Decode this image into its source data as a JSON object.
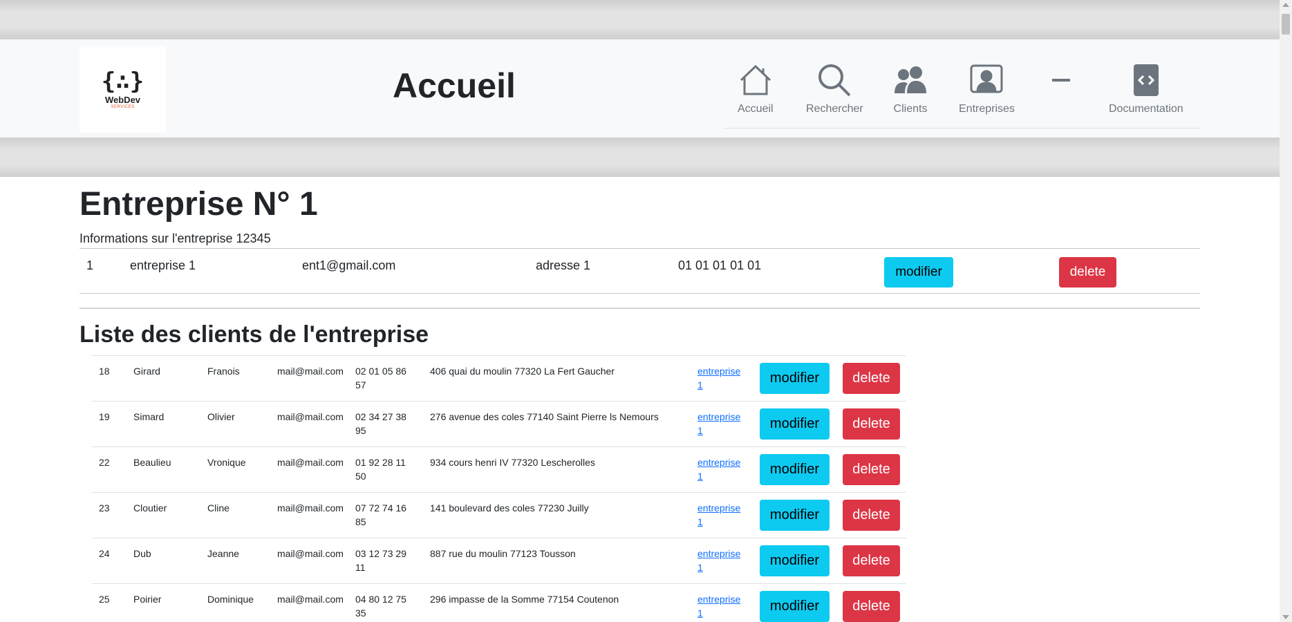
{
  "header": {
    "logo": {
      "mark": "{∴}",
      "name": "WebDev",
      "tagline": "SERVICES"
    },
    "title": "Accueil",
    "nav": [
      {
        "label": "Accueil",
        "icon": "house-icon"
      },
      {
        "label": "Rechercher",
        "icon": "search-icon"
      },
      {
        "label": "Clients",
        "icon": "people-icon"
      },
      {
        "label": "Entreprises",
        "icon": "person-badge-icon"
      },
      {
        "label": "",
        "icon": "dash-icon"
      },
      {
        "label": "Documentation",
        "icon": "code-square-icon"
      }
    ]
  },
  "entreprise": {
    "title": "Entreprise N° 1",
    "info": "Informations sur l'entreprise 12345",
    "id": "1",
    "name": "entreprise 1",
    "email": "ent1@gmail.com",
    "address": "adresse 1",
    "phone": "01 01 01 01 01",
    "modify_label": "modifier",
    "delete_label": "delete"
  },
  "clients": {
    "title": "Liste des clients de l'entreprise",
    "modify_label": "modifier",
    "delete_label": "delete",
    "rows": [
      {
        "id": "18",
        "nom": "Girard",
        "prenom": "Franois",
        "email": "mail@mail.com",
        "tel1": "02 01 05 86",
        "tel2": "57",
        "adresse": "406 quai du moulin 77320 La Fert Gaucher",
        "ent1": "entreprise",
        "ent2": "1"
      },
      {
        "id": "19",
        "nom": "Simard",
        "prenom": "Olivier",
        "email": "mail@mail.com",
        "tel1": "02 34 27 38",
        "tel2": "95",
        "adresse": "276 avenue des coles 77140 Saint Pierre ls Nemours",
        "ent1": "entreprise",
        "ent2": "1"
      },
      {
        "id": "22",
        "nom": "Beaulieu",
        "prenom": "Vronique",
        "email": "mail@mail.com",
        "tel1": "01 92 28 11",
        "tel2": "50",
        "adresse": "934 cours henri IV 77320 Lescherolles",
        "ent1": "entreprise",
        "ent2": "1"
      },
      {
        "id": "23",
        "nom": "Cloutier",
        "prenom": "Cline",
        "email": "mail@mail.com",
        "tel1": "07 72 74 16",
        "tel2": "85",
        "adresse": "141 boulevard des coles 77230 Juilly",
        "ent1": "entreprise",
        "ent2": "1"
      },
      {
        "id": "24",
        "nom": "Dub",
        "prenom": "Jeanne",
        "email": "mail@mail.com",
        "tel1": "03 12 73 29",
        "tel2": "11",
        "adresse": "887 rue du moulin 77123 Tousson",
        "ent1": "entreprise",
        "ent2": "1"
      },
      {
        "id": "25",
        "nom": "Poirier",
        "prenom": "Dominique",
        "email": "mail@mail.com",
        "tel1": "04 80 12 75",
        "tel2": "35",
        "adresse": "296 impasse de la Somme 77154 Coutenon",
        "ent1": "entreprise",
        "ent2": "1"
      }
    ]
  },
  "colors": {
    "info": "#0dcaf0",
    "danger": "#dc3545",
    "nav_icon": "#6c757d",
    "link": "#0d6efd"
  }
}
